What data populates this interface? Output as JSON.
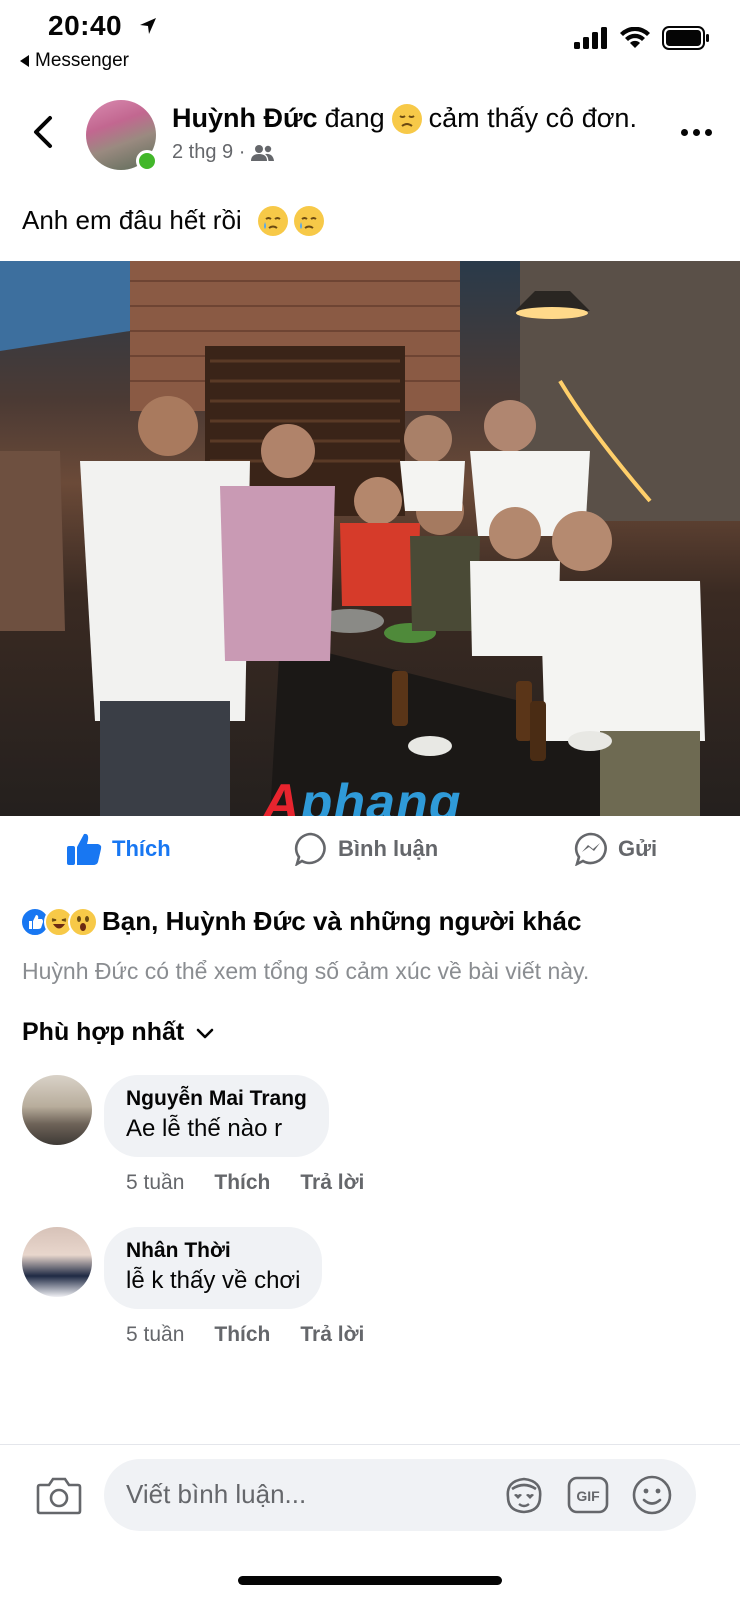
{
  "status_bar": {
    "time": "20:40",
    "back_app": "Messenger"
  },
  "post": {
    "author": "Huỳnh Đức",
    "feeling_prefix": "đang",
    "feeling_text": "cảm thấy cô đơn.",
    "date": "2 thg 9 ·",
    "text": "Anh em đâu hết rồi",
    "watermark": {
      "first": "A",
      "rest": "phang"
    }
  },
  "actions": {
    "like": "Thích",
    "comment": "Bình luận",
    "send": "Gửi"
  },
  "reactions": {
    "summary": "Bạn, Huỳnh Đức và những người khác",
    "note": "Huỳnh Đức có thể xem tổng số cảm xúc về bài viết này."
  },
  "sort_label": "Phù hợp nhất",
  "comments": [
    {
      "name": "Nguyễn Mai Trang",
      "text": "Ae lễ thế nào r",
      "time": "5 tuần",
      "like": "Thích",
      "reply": "Trả lời"
    },
    {
      "name": "Nhân Thời",
      "text": "lễ k thấy về chơi",
      "time": "5 tuần",
      "like": "Thích",
      "reply": "Trả lời"
    }
  ],
  "composer": {
    "placeholder": "Viết bình luận...",
    "gif_label": "GIF"
  },
  "colors": {
    "accent": "#1877f2",
    "online": "#42b72a",
    "bubble": "#f0f2f5",
    "secondary_text": "#65676b"
  },
  "icons": [
    "location-arrow-icon",
    "signal-icon",
    "wifi-icon",
    "battery-icon",
    "back-chevron-icon",
    "friends-icon",
    "more-icon",
    "like-icon",
    "comment-icon",
    "messenger-icon",
    "chevron-down-icon",
    "camera-icon",
    "avatar-sticker-icon",
    "gif-icon",
    "emoji-icon"
  ]
}
